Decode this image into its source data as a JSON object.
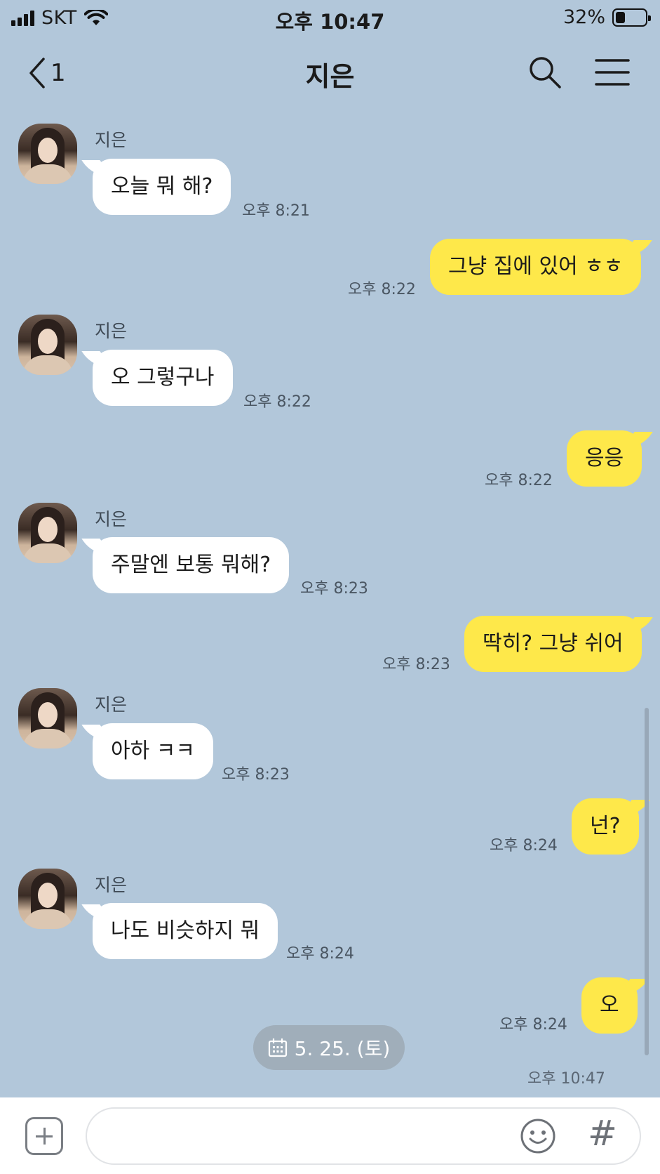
{
  "status_bar": {
    "carrier": "SKT",
    "time": "오후 10:47",
    "battery": "32%",
    "battery_level": 0.32
  },
  "header": {
    "back_count": "1",
    "title": "지은"
  },
  "messages": [
    {
      "sender": "지은",
      "text": "오늘 뭐 해?",
      "time": "오후 8:21"
    },
    {
      "text": "그냥 집에 있어 ㅎㅎ",
      "time": "오후 8:22"
    },
    {
      "sender": "지은",
      "text": "오 그렇구나",
      "time": "오후 8:22"
    },
    {
      "text": "응응",
      "time": "오후 8:22"
    },
    {
      "sender": "지은",
      "text": "주말엔 보통 뭐해?",
      "time": "오후 8:23"
    },
    {
      "text": "딱히? 그냥 쉬어",
      "time": "오후 8:23"
    },
    {
      "sender": "지은",
      "text": "아하 ㅋㅋ",
      "time": "오후 8:23"
    },
    {
      "text": "넌?",
      "time": "오후 8:24"
    },
    {
      "sender": "지은",
      "text": "나도 비슷하지 뭐",
      "time": "오후 8:24"
    },
    {
      "text": "오",
      "time": "오후 8:24"
    }
  ],
  "date_pill": "5. 25. (토)",
  "last_time": "오후 10:47",
  "input": {
    "placeholder": "",
    "hash_label": "#"
  },
  "icons": [
    "chevron-left-icon",
    "search-icon",
    "menu-icon",
    "calendar-icon",
    "plus-icon",
    "emoji-icon"
  ]
}
